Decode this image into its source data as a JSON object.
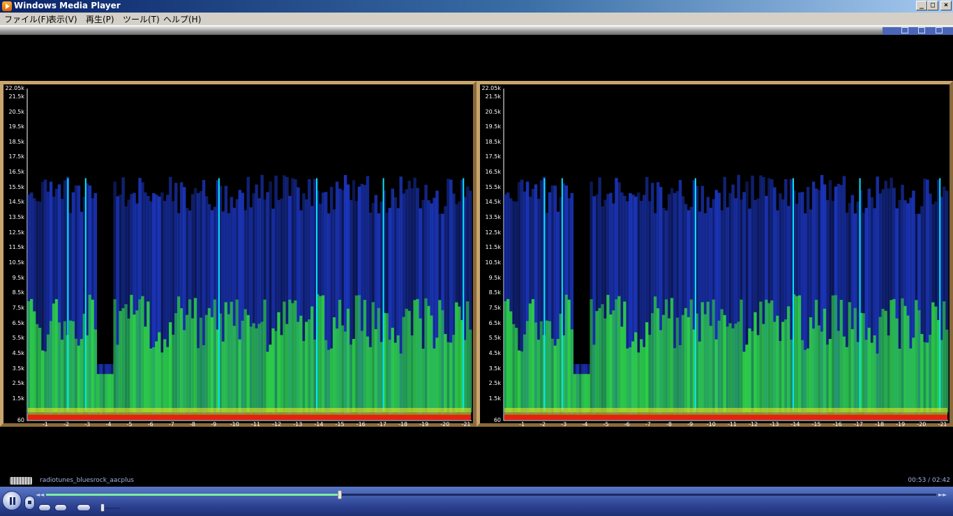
{
  "window": {
    "title": "Windows Media Player",
    "min": "_",
    "max": "□",
    "close": "×"
  },
  "menu": [
    "ファイル(F)",
    "表示(V)",
    "再生(P)",
    "ツール(T)",
    "ヘルプ(H)"
  ],
  "spectrogram": {
    "y_ticks": [
      "22.05k",
      "21.5k",
      "20.5k",
      "19.5k",
      "18.5k",
      "17.5k",
      "16.5k",
      "15.5k",
      "14.5k",
      "13.5k",
      "12.5k",
      "11.5k",
      "10.5k",
      "9.5k",
      "8.5k",
      "7.5k",
      "6.5k",
      "5.5k",
      "4.5k",
      "3.5k",
      "2.5k",
      "1.5k",
      "60"
    ],
    "x_ticks": [
      "-1",
      "-2",
      "-3",
      "-4",
      "-5",
      "-6",
      "-7",
      "-8",
      "-9",
      "-10",
      "-11",
      "-12",
      "-13",
      "-14",
      "-15",
      "-16",
      "-17",
      "-18",
      "-19",
      "-20",
      "-21"
    ],
    "colors": {
      "low": "#e82010",
      "mid": "#30e040",
      "high": "#2040e0",
      "peak": "#00e8ff"
    }
  },
  "status": {
    "track": "radiotunes_bluesrock_aacplus",
    "time": "00:53 / 02:42"
  },
  "transport": {
    "seek_fraction": 0.33,
    "volume_fraction": 0.1
  },
  "icons": {
    "pause": "pause-icon",
    "stop": "stop-icon",
    "prev": "previous-icon",
    "next": "next-icon",
    "mute": "mute-icon"
  }
}
